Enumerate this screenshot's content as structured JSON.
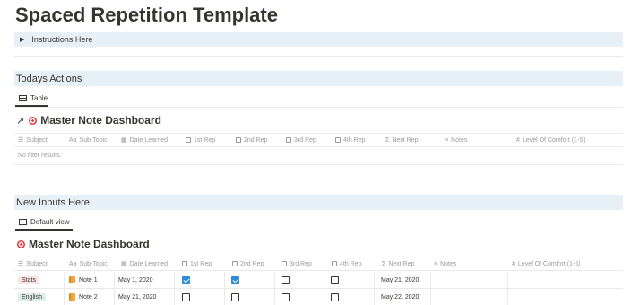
{
  "page": {
    "title": "Spaced Repetition Template"
  },
  "toggle": {
    "label": "Instructions Here"
  },
  "today": {
    "heading": "Todays Actions",
    "view_tab": "Table",
    "db_title": "Master Note Dashboard",
    "empty_text": "No filter results."
  },
  "columns": {
    "subject": "Subject",
    "subtopic": "Sub-Topic",
    "date_learned": "Date Learned",
    "rep1": "1st Rep",
    "rep2": "2nd Rep",
    "rep3": "3rd Rep",
    "rep4": "4th Rep",
    "next_rep": "Next Rep",
    "notes": "Notes",
    "comfort": "Level Of Comfort (1-5)"
  },
  "column_icons": {
    "subject": "list-icon",
    "subtopic": "Aa",
    "date_learned": "calendar-icon",
    "rep": "checkbox-icon",
    "next_rep": "Σ",
    "notes": "lines-icon",
    "comfort": "#"
  },
  "new_inputs": {
    "heading": "New Inputs Here",
    "view_tab": "Default view",
    "db_title": "Master Note Dashboard",
    "rows": [
      {
        "subject": "Stats",
        "subject_color": "#fbe4e4",
        "subtopic": "Note 1",
        "date_learned": "May 1, 2020",
        "rep1": true,
        "rep2": true,
        "rep3": false,
        "rep4": false,
        "next_rep": "May 21, 2020"
      },
      {
        "subject": "English",
        "subject_color": "#ddedea",
        "subtopic": "Note 2",
        "date_learned": "May 21, 2020",
        "rep1": false,
        "rep2": false,
        "rep3": false,
        "rep4": false,
        "next_rep": "May 22, 2020"
      }
    ]
  },
  "colors": {
    "accent_blue": "#2e8ad8",
    "heading_bg": "#e7f0f7",
    "muted_text": "#9b9a97"
  }
}
